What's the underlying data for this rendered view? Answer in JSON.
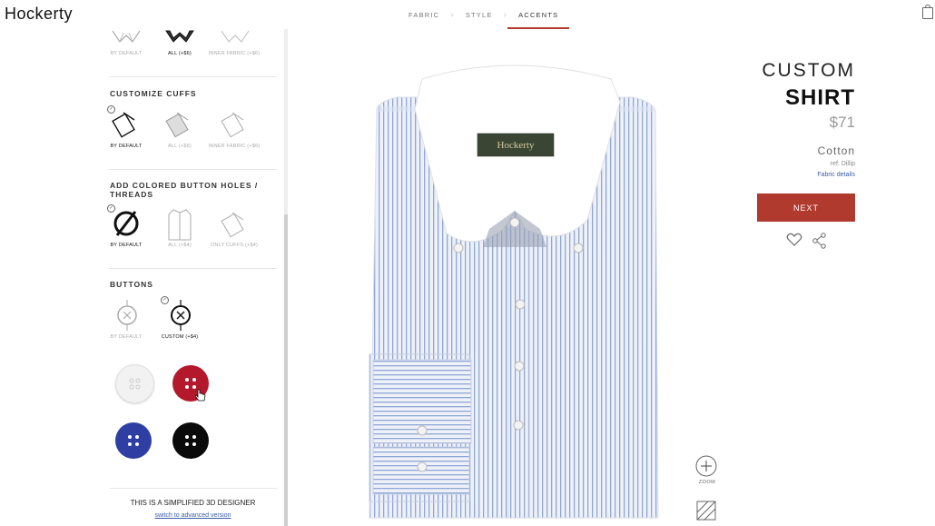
{
  "header": {
    "logo": "Hockerty",
    "tabs": [
      {
        "label": "FABRIC"
      },
      {
        "label": "STYLE"
      },
      {
        "label": "ACCENTS"
      }
    ],
    "cart_icon": "bag-icon"
  },
  "sidebar": {
    "collar_options": [
      {
        "label": "BY DEFAULT",
        "selected": false
      },
      {
        "label": "ALL (+$6)",
        "selected": true
      },
      {
        "label": "INNER FABRIC (+$6)",
        "selected": false
      }
    ],
    "cuffs": {
      "title": "CUSTOMIZE CUFFS",
      "options": [
        {
          "label": "BY DEFAULT",
          "selected": true
        },
        {
          "label": "ALL (+$6)",
          "selected": false
        },
        {
          "label": "INNER FABRIC (+$6)",
          "selected": false
        }
      ]
    },
    "button_holes": {
      "title_line1": "ADD COLORED BUTTON HOLES /",
      "title_line2": "THREADS",
      "options": [
        {
          "label": "BY DEFAULT",
          "selected": true
        },
        {
          "label": "ALL (+$4)",
          "selected": false
        },
        {
          "label": "ONLY CUFFS (+$4)",
          "selected": false
        }
      ]
    },
    "buttons": {
      "title": "BUTTONS",
      "options": [
        {
          "label": "BY DEFAULT",
          "selected": false
        },
        {
          "label": "CUSTOM (+$4)",
          "selected": true
        }
      ],
      "swatches": [
        {
          "color": "#f2f2f2"
        },
        {
          "color": "#b3182b"
        },
        {
          "color": "#2f3ea3"
        },
        {
          "color": "#0a0a0a"
        }
      ]
    },
    "footer": {
      "text": "THIS IS A SIMPLIFIED 3D DESIGNER",
      "link": "switch to advanced version"
    }
  },
  "shirt": {
    "label_text": "Hockerty",
    "stripe_color": "#8fa6d8",
    "base_color": "#eef1f8",
    "collar_color": "#ffffff"
  },
  "product": {
    "title_line1": "CUSTOM",
    "title_line2": "SHIRT",
    "price": "$71",
    "fabric": "Cotton",
    "ref": "ref: Dillip",
    "fabric_link": "Fabric details",
    "next_label": "NEXT",
    "zoom_label": "ZOOM"
  }
}
